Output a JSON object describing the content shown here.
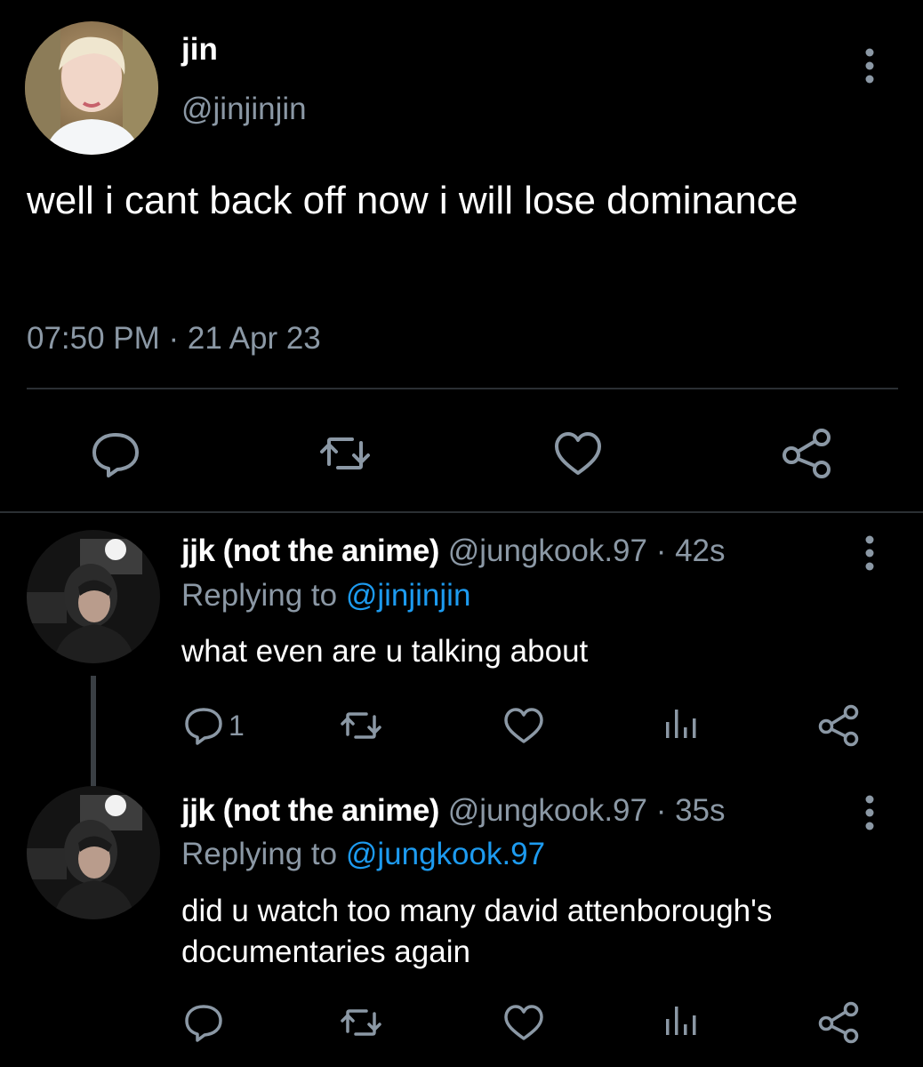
{
  "main_tweet": {
    "name": "jin",
    "handle": "@jinjinjin",
    "text": "well i cant back off now i will lose dominance",
    "timestamp": "07:50 PM · 21 Apr 23",
    "actions": [
      "reply-icon",
      "retweet-icon",
      "like-icon",
      "share-icon"
    ]
  },
  "replies": [
    {
      "name": "jjk (not the anime)",
      "meta": " @jungkook.97 · 42s",
      "replying_prefix": "Replying to ",
      "replying_to": "@jinjinjin",
      "text": "what even are u talking about",
      "reply_count": "1"
    },
    {
      "name": "jjk (not the anime)",
      "meta": " @jungkook.97 · 35s",
      "replying_prefix": "Replying to ",
      "replying_to": "@jungkook.97",
      "text": "did u watch too many david attenborough's documentaries again",
      "reply_count": ""
    }
  ],
  "colors": {
    "background": "#000000",
    "text_primary": "#ffffff",
    "text_secondary": "#8b98a5",
    "mention": "#1d9bf0",
    "divider": "#2b2f33"
  }
}
